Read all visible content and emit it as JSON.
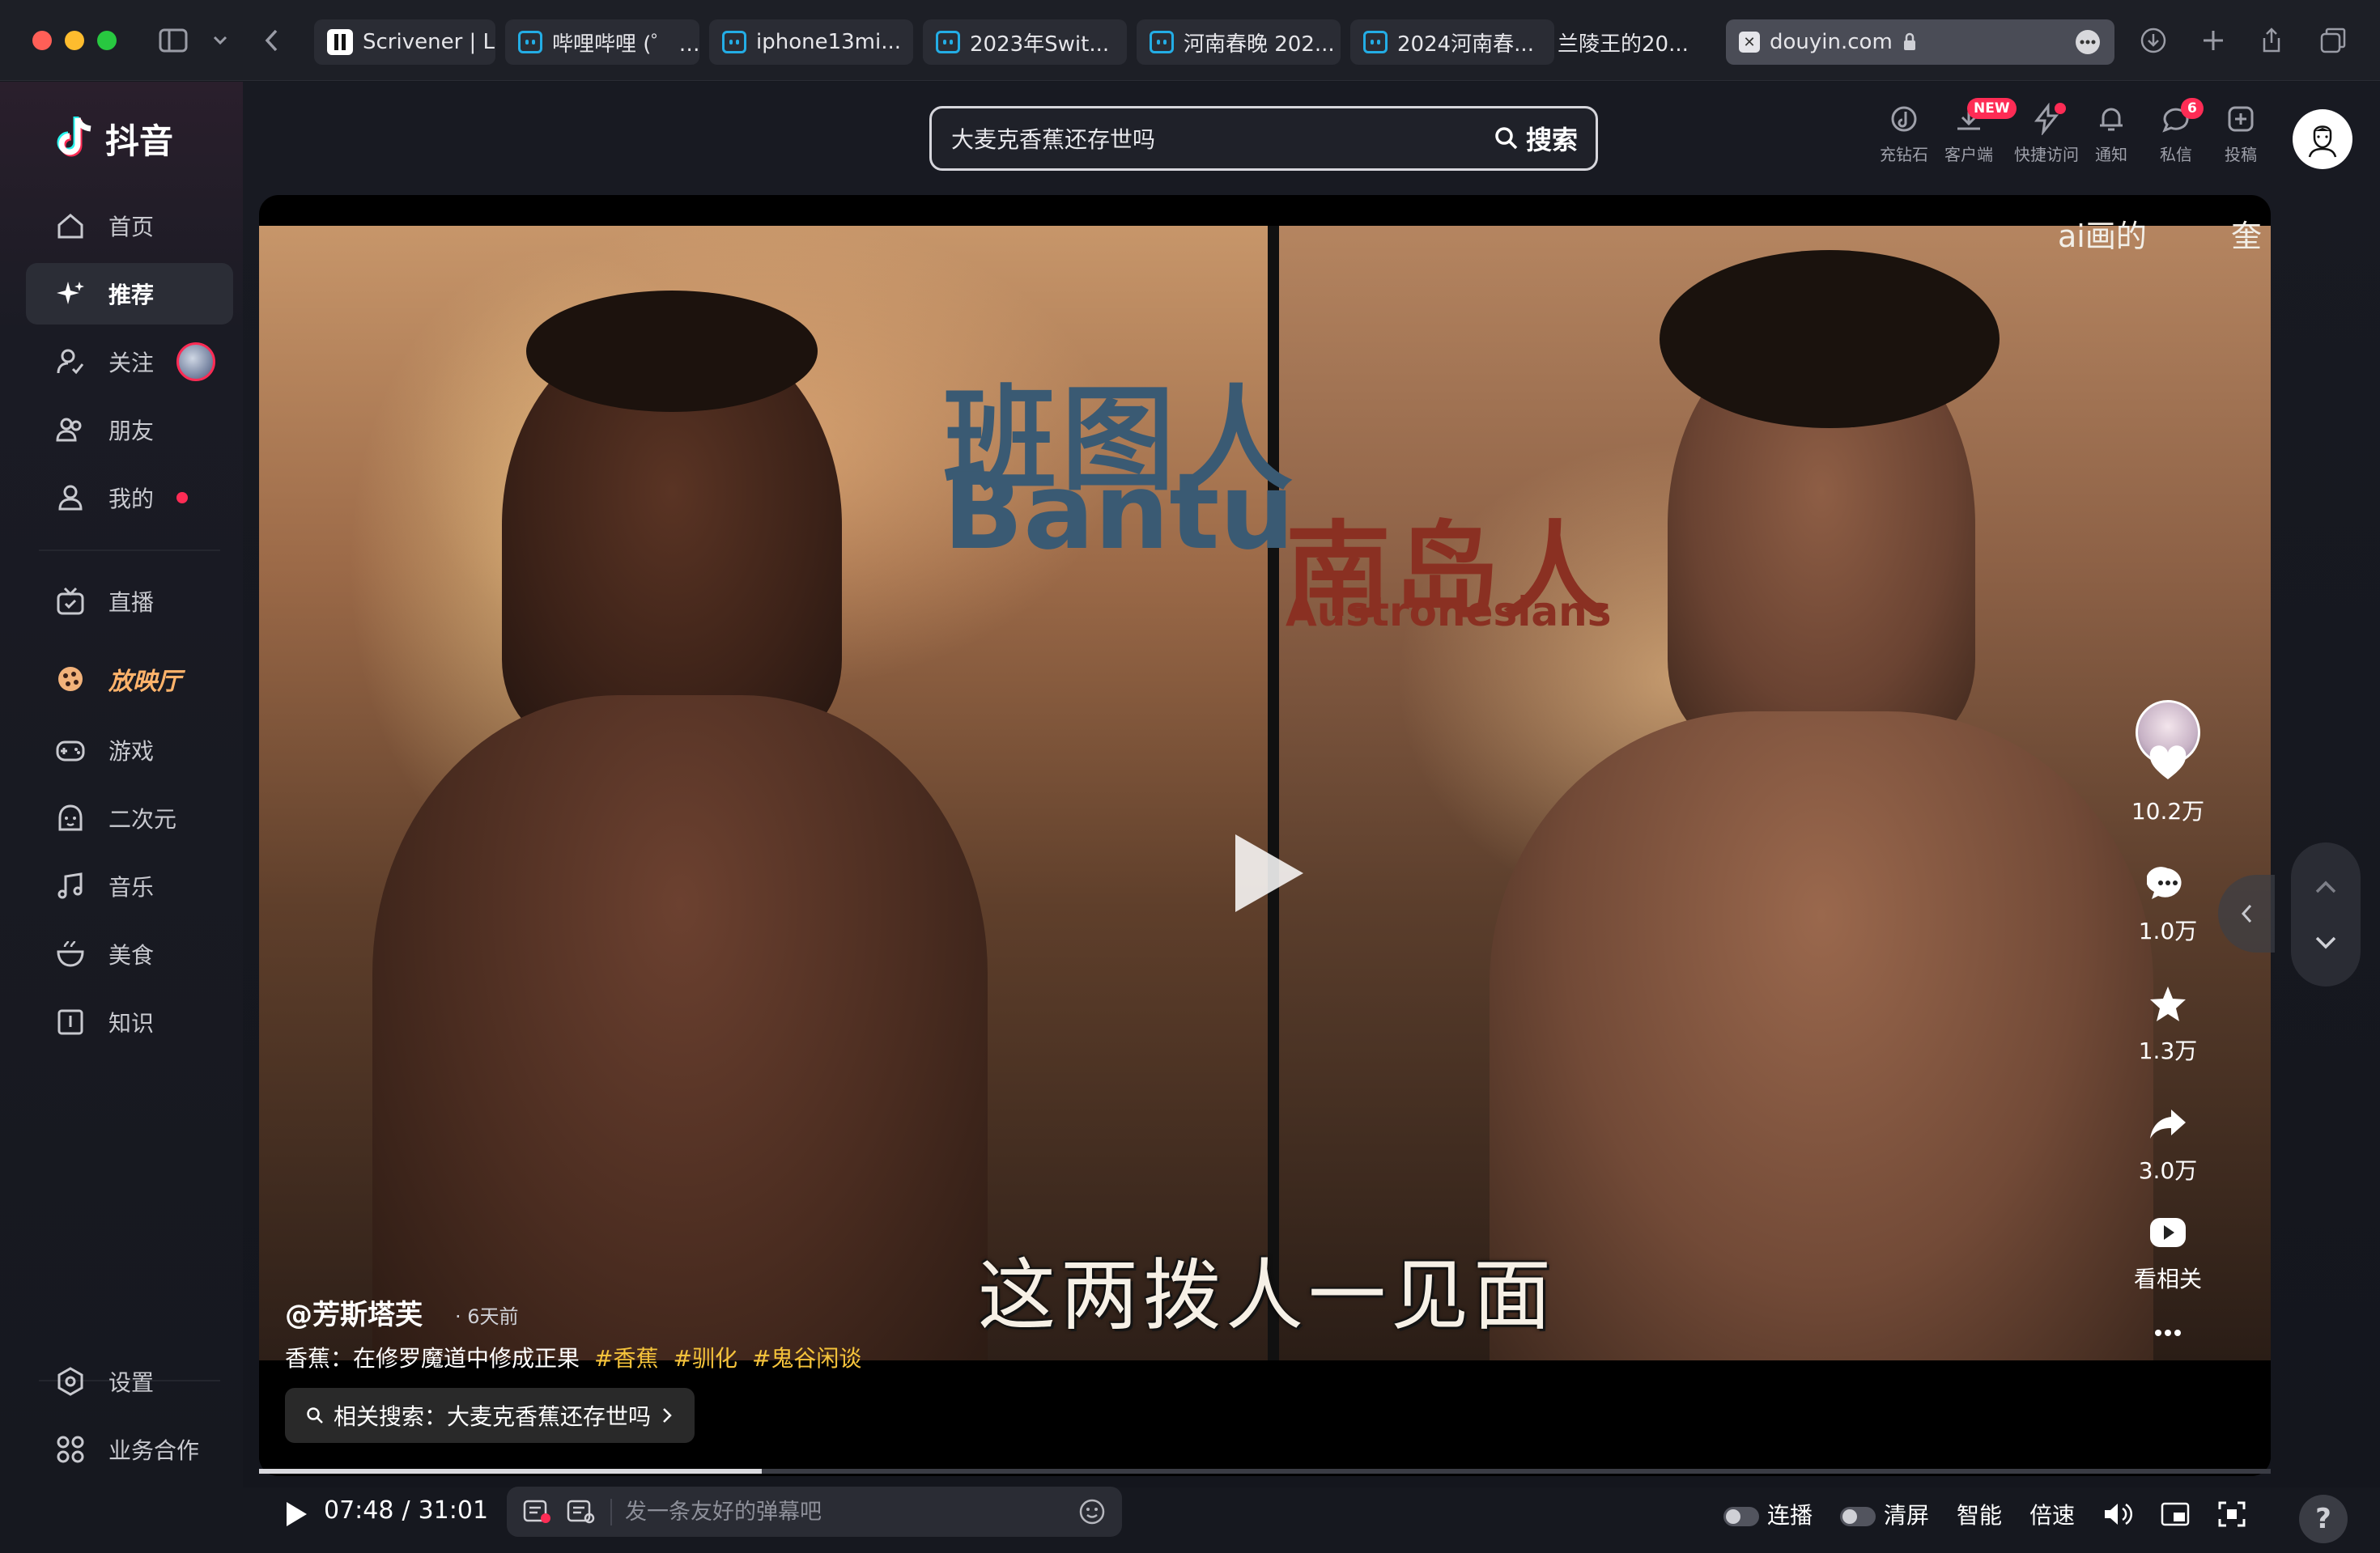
{
  "browser": {
    "tabs": [
      {
        "label": "Scrivener | Li",
        "icon": "scrivener-icon"
      },
      {
        "label": "哔哩哔哩 (゜ …",
        "icon": "bilibili-icon"
      },
      {
        "label": "iphone13mi...",
        "icon": "bilibili-icon"
      },
      {
        "label": "2023年Swit...",
        "icon": "bilibili-icon"
      },
      {
        "label": "河南春晚 202...",
        "icon": "bilibili-icon"
      },
      {
        "label": "2024河南春...",
        "icon": "bilibili-icon"
      },
      {
        "label": "兰陵王的20...",
        "icon": "none"
      }
    ],
    "active_tab": {
      "label": "douyin.com",
      "icon": "lock-icon"
    }
  },
  "app": {
    "logo_text": "抖音",
    "brand_colors": {
      "accent": "#fe2c55",
      "cyan": "#25f4ee"
    }
  },
  "sidebar": {
    "items": [
      {
        "label": "首页",
        "icon": "home-icon"
      },
      {
        "label": "推荐",
        "icon": "sparkle-icon",
        "active": true
      },
      {
        "label": "关注",
        "icon": "follow-icon"
      },
      {
        "label": "朋友",
        "icon": "friends-icon"
      },
      {
        "label": "我的",
        "icon": "user-icon"
      },
      {
        "label": "直播",
        "icon": "tv-icon"
      },
      {
        "label": "放映厅",
        "icon": "cinema-icon"
      },
      {
        "label": "游戏",
        "icon": "gamepad-icon"
      },
      {
        "label": "二次元",
        "icon": "anime-icon"
      },
      {
        "label": "音乐",
        "icon": "music-icon"
      },
      {
        "label": "美食",
        "icon": "food-icon"
      },
      {
        "label": "知识",
        "icon": "knowledge-icon"
      }
    ],
    "bottom": [
      {
        "label": "设置",
        "icon": "settings-icon"
      },
      {
        "label": "业务合作",
        "icon": "grid-icon"
      }
    ]
  },
  "search": {
    "value": "大麦克香蕉还存世吗",
    "button_label": "搜索"
  },
  "topbar": {
    "items": [
      {
        "label": "充钻石",
        "icon": "diamond-icon"
      },
      {
        "label": "客户端",
        "icon": "download-icon",
        "badge": "NEW"
      },
      {
        "label": "快捷访问",
        "icon": "lightning-icon",
        "badge_dot": true
      },
      {
        "label": "通知",
        "icon": "bell-icon"
      },
      {
        "label": "私信",
        "icon": "message-icon",
        "badge": "6"
      },
      {
        "label": "投稿",
        "icon": "upload-icon"
      }
    ]
  },
  "video": {
    "overlay_top_right": "ai画的",
    "overlay_top_right_2": "奎",
    "left_label_cn": "班图人",
    "left_label_en": "Bantu",
    "right_label_cn": "南岛人",
    "right_label_en": "Austronesians",
    "subtitle": "这两拨人一见面",
    "author": "@芳斯塔芙",
    "time_ago": "· 6天前",
    "description": "香蕉：在修罗魔道中修成正果",
    "tags": [
      "#香蕉",
      "#驯化",
      "#鬼谷闲谈"
    ],
    "related_search": "相关搜索：大麦克香蕉还存世吗",
    "actions": {
      "likes": "10.2万",
      "comments": "1.0万",
      "favorites": "1.3万",
      "shares": "3.0万",
      "related_label": "看相关"
    },
    "progress": 0.25
  },
  "player": {
    "current_time": "07:48",
    "separator": "/",
    "total_time": "31:01",
    "danmu_placeholder": "发一条友好的弹幕吧",
    "autoplay_label": "连播",
    "clear_label": "清屏",
    "quality_label": "智能",
    "speed_label": "倍速"
  }
}
